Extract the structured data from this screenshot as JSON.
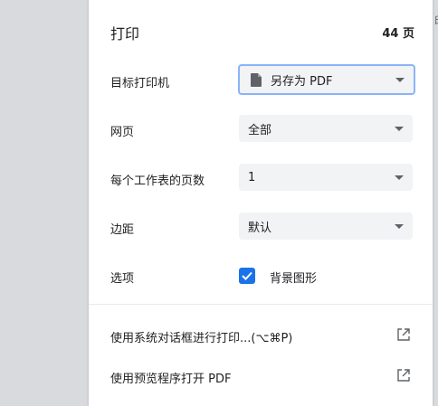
{
  "panel": {
    "title": "打印",
    "page_count": "44 页"
  },
  "rows": {
    "destination": {
      "label": "目标打印机",
      "value": "另存为 PDF"
    },
    "pages": {
      "label": "网页",
      "value": "全部"
    },
    "pages_per_sheet": {
      "label": "每个工作表的页数",
      "value": "1"
    },
    "margins": {
      "label": "边距",
      "value": "默认"
    },
    "options": {
      "label": "选项",
      "checkbox_label": "背景图形",
      "checked": true
    }
  },
  "links": {
    "system_dialog": "使用系统对话框进行打印...(⌥⌘P)",
    "open_preview": "使用预览程序打开 PDF"
  },
  "edge_text": "印",
  "colors": {
    "accent": "#1a73e8",
    "focus_ring": "#8ab4f8",
    "select_bg": "#f1f3f4",
    "backdrop": "#d9dadd"
  }
}
